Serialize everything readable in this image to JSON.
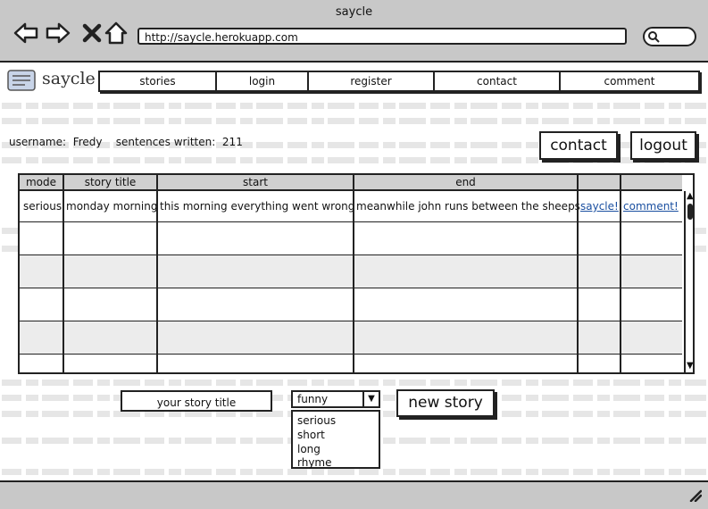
{
  "window": {
    "title": "saycle",
    "url": "http://saycle.herokuapp.com"
  },
  "brand": {
    "name": "saycle"
  },
  "menu": [
    {
      "label": "stories",
      "active": true
    },
    {
      "label": "login",
      "active": false
    },
    {
      "label": "register",
      "active": false
    },
    {
      "label": "contact",
      "active": false
    },
    {
      "label": "comment",
      "active": false
    }
  ],
  "user": {
    "username_label": "username:",
    "username": "Fredy",
    "sentences_label": "sentences written:",
    "sentences": "211"
  },
  "buttons": {
    "contact": "contact",
    "logout": "logout",
    "new_story": "new story"
  },
  "table": {
    "columns": [
      "mode",
      "story title",
      "start",
      "end",
      "",
      ""
    ],
    "rows": [
      {
        "mode": "serious",
        "title": "monday morning",
        "start": "this morning everything went wrong",
        "end": "meanwhile john runs between the sheeps",
        "action1": "saycle!",
        "action2": "comment!"
      }
    ]
  },
  "form": {
    "title_placeholder": "your story title",
    "mode_selected": "funny",
    "mode_options": [
      "serious",
      "short",
      "long",
      "rhyme"
    ]
  },
  "icons": [
    "back-icon",
    "forward-icon",
    "close-icon",
    "home-icon",
    "search-icon",
    "logo-icon",
    "resize-icon"
  ],
  "colors": {
    "chrome": "#c8c8c8",
    "active_tab": "#9ec0f0",
    "link": "#1a4fa0"
  }
}
